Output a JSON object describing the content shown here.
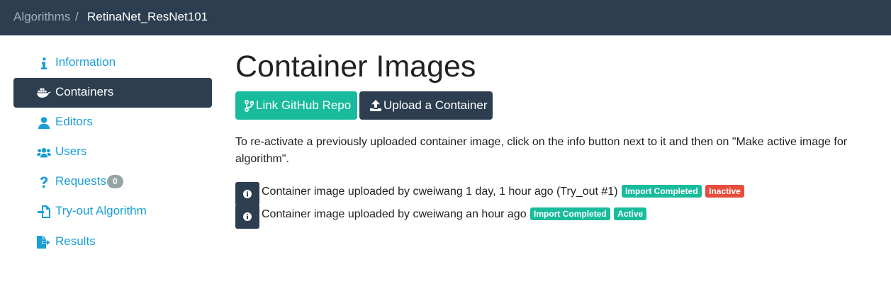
{
  "breadcrumb": {
    "parent": "Algorithms",
    "separator": "/",
    "current": "RetinaNet_ResNet101"
  },
  "sidebar": {
    "items": [
      {
        "label": "Information",
        "icon": "info-icon",
        "active": false
      },
      {
        "label": "Containers",
        "icon": "docker-icon",
        "active": true
      },
      {
        "label": "Editors",
        "icon": "user-icon",
        "active": false
      },
      {
        "label": "Users",
        "icon": "users-icon",
        "active": false
      },
      {
        "label": "Requests",
        "icon": "question-icon",
        "active": false,
        "badge": "0"
      },
      {
        "label": "Try-out Algorithm",
        "icon": "file-import-icon",
        "active": false
      },
      {
        "label": "Results",
        "icon": "file-export-icon",
        "active": false
      }
    ]
  },
  "main": {
    "title": "Container Images",
    "buttons": {
      "github": "Link GitHub Repo",
      "upload": "Upload a Container"
    },
    "description": "To re-activate a previously uploaded container image, click on the info button next to it and then on \"Make active image for algorithm\".",
    "images": [
      {
        "text": "Container image uploaded by cweiwang 1 day, 1 hour ago (Try_out #1)",
        "status": "Import Completed",
        "state": "Inactive"
      },
      {
        "text": "Container image uploaded by cweiwang an hour ago",
        "status": "Import Completed",
        "state": "Active"
      }
    ]
  },
  "colors": {
    "navbar": "#2c3e50",
    "link": "#1a9ed6",
    "success": "#18bc9c",
    "danger": "#e74c3c",
    "badge": "#95a5a6"
  }
}
